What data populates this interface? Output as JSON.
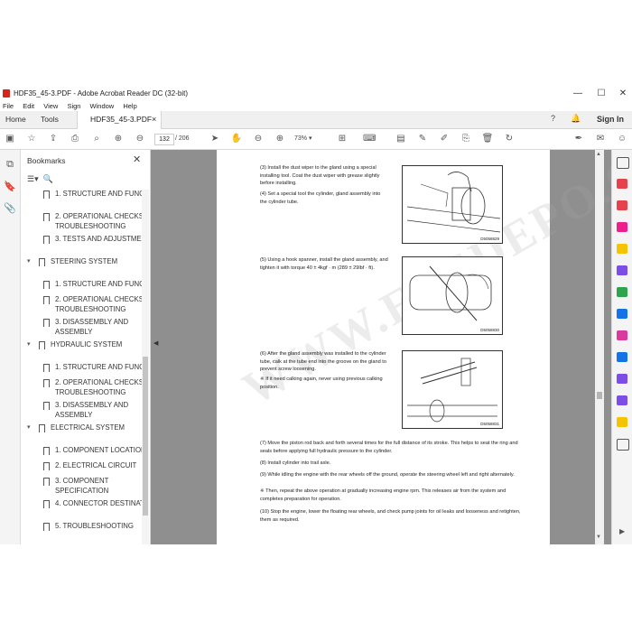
{
  "window": {
    "title": "HDF35_45-3.PDF - Adobe Acrobat Reader DC (32-bit)",
    "minimize": "—",
    "maximize": "☐",
    "close": "✕"
  },
  "menu": [
    "File",
    "Edit",
    "View",
    "Sign",
    "Window",
    "Help"
  ],
  "tabs": {
    "home": "Home",
    "tools": "Tools",
    "document": "HDF35_45-3.PDF",
    "close": "×"
  },
  "account": {
    "sign_in": "Sign In"
  },
  "toolbar": {
    "page_current": "132",
    "page_total": "/ 206",
    "zoom": "73%"
  },
  "bookmarks": {
    "title": "Bookmarks",
    "items": [
      {
        "label": "1. STRUCTURE AND FUNCTION",
        "level": 2
      },
      {
        "label": "2. OPERATIONAL CHECKS AND TROUBLESHOOTING",
        "level": 2
      },
      {
        "label": "3. TESTS AND ADJUSTMENTS",
        "level": 2
      },
      {
        "label": "STEERING SYSTEM",
        "level": 1
      },
      {
        "label": "1. STRUCTURE AND FUNCTION",
        "level": 2
      },
      {
        "label": "2. OPERATIONAL CHECKS AND TROUBLESHOOTING",
        "level": 2
      },
      {
        "label": "3. DISASSEMBLY AND ASSEMBLY",
        "level": 2
      },
      {
        "label": "HYDRAULIC SYSTEM",
        "level": 1
      },
      {
        "label": "1. STRUCTURE AND FUNCTION",
        "level": 2
      },
      {
        "label": "2. OPERATIONAL CHECKS AND TROUBLESHOOTING",
        "level": 2
      },
      {
        "label": "3. DISASSEMBLY AND ASSEMBLY",
        "level": 2
      },
      {
        "label": "ELECTRICAL SYSTEM",
        "level": 1
      },
      {
        "label": "1. COMPONENT LOCATION",
        "level": 2
      },
      {
        "label": "2. ELECTRICAL CIRCUIT",
        "level": 2
      },
      {
        "label": "3. COMPONENT SPECIFICATION",
        "level": 2
      },
      {
        "label": "4. CONNECTOR DESTINATION",
        "level": 2
      },
      {
        "label": "5. TROUBLESHOOTING",
        "level": 2
      }
    ]
  },
  "document": {
    "watermark": "WWW.EPCDEPO.COM",
    "steps": {
      "s3": "(3) Install the dust wiper to the gland using a special installing tool. Coat the dust wiper with grease slightly before installing.",
      "s4": "(4) Set a special tool the cylinder, gland assembly into the cylinder tube.",
      "s5": "(5) Using a hook spanner, install the gland assembly, and tighten it with torque 40 ± 4kgf · m (289 ± 29lbf · ft).",
      "s6": "(6) After the gland assembly was installed to the cylinder tube, calk at the tube end into the groove on the gland to prevent screw loosening.",
      "s6note": "※ If it need calking again, never using previous calking position.",
      "s7": "(7) Move the piston rod back and forth several times for the full distance of its stroke. This helps to seat the ring and seals before applying full hydraulic pressure to the cylinder.",
      "s8": "(8) Install cylinder into trail axle.",
      "s9": "(9) While idling the engine with the rear wheels off the ground, operate the steering wheel left and right alternately.",
      "s9note": "※ Then, repeat the above operation at gradually increasing engine rpm. This releases air from the system and completes preparation for operation.",
      "s10": "(10) Stop the engine, lower the floating rear wheels, and check pump joints for oil leaks and looseness and retighten, them as required."
    },
    "figures": {
      "f1": "D5058829",
      "f2": "D5058830",
      "f3": "D5058831"
    }
  }
}
